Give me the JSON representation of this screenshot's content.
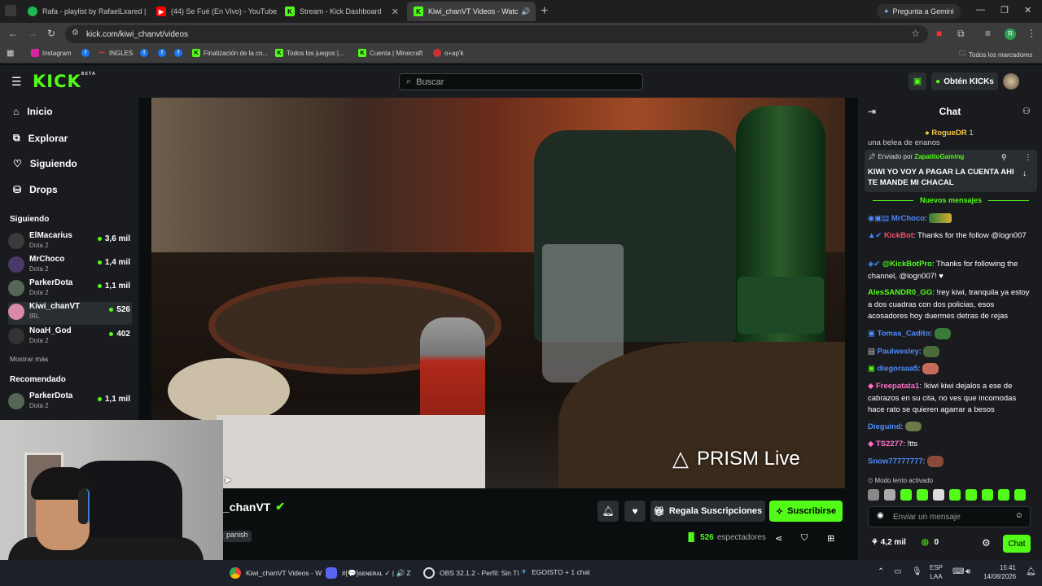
{
  "browser": {
    "tabs": [
      {
        "title": "Rafa - playlist by RafaelLxared |",
        "icon": "spotify-icon",
        "color": "#1db954"
      },
      {
        "title": "(44) Se Fué (En Vivo) - YouTube",
        "icon": "youtube-icon",
        "color": "#ff0000"
      },
      {
        "title": "Stream - Kick Dashboard",
        "icon": "kick-icon",
        "color": "#53fc18"
      },
      {
        "title": "Kiwi_chanVT Videos - Watc",
        "icon": "kick-icon",
        "color": "#53fc18"
      }
    ],
    "gemini_label": "Pregunta a Gemini",
    "url": "kick.com/kiwi_chanvt/videos",
    "bookmarks": [
      {
        "label": "Instagram",
        "icon": "instagram-icon"
      },
      {
        "label": "",
        "icon": "facebook-icon"
      },
      {
        "label": "INGLES",
        "icon": "ingles-icon"
      },
      {
        "label": "",
        "icon": "facebook-icon"
      },
      {
        "label": "",
        "icon": "facebook-icon"
      },
      {
        "label": "",
        "icon": "facebook-icon"
      },
      {
        "label": "Finalización de la co...",
        "icon": "bookmark-icon"
      },
      {
        "label": "Todos los juegos |...",
        "icon": "bookmark-icon"
      },
      {
        "label": "Cuenta | Minecraft",
        "icon": "bookmark-icon"
      },
      {
        "label": "o+ap'k",
        "icon": "bookmark-icon"
      }
    ],
    "all_bookmarks": "Todos los marcadores"
  },
  "kick": {
    "logo": "KICK",
    "logo_badge": "BETA",
    "search_placeholder": "Buscar",
    "get_kicks": "Obtén KICKs",
    "nav": [
      {
        "label": "Inicio",
        "icon": "home-icon"
      },
      {
        "label": "Explorar",
        "icon": "compass-icon"
      },
      {
        "label": "Siguiendo",
        "icon": "heart-icon"
      },
      {
        "label": "Drops",
        "icon": "drops-icon"
      }
    ],
    "following_title": "Siguiendo",
    "following": [
      {
        "name": "ElMacarius",
        "game": "Dota 2",
        "viewers": "3,6 mil",
        "color": "#3a3a3a"
      },
      {
        "name": "MrChoco",
        "game": "Dota 2",
        "viewers": "1,4 mil",
        "color": "#4a3a6a"
      },
      {
        "name": "ParkerDota",
        "game": "Dota 2",
        "viewers": "1,1 mil",
        "color": "#556655"
      },
      {
        "name": "Kiwi_chanVT",
        "game": "IRL",
        "viewers": "526",
        "color": "#d88aa6"
      },
      {
        "name": "NoaH_God",
        "game": "Dota 2",
        "viewers": "402",
        "color": "#333"
      }
    ],
    "show_more": "Mostrar más",
    "recommended_title": "Recomendado",
    "recommended": [
      {
        "name": "ParkerDota",
        "game": "Dota 2",
        "viewers": "1,1 mil",
        "color": "#556655"
      }
    ],
    "prism": "PRISM Live",
    "channel_name": "_chanVT",
    "language": "panish",
    "gift_label": "Regala Suscripciones",
    "subscribe_label": "Suscribirse",
    "viewers_count": "526",
    "viewers_label": "espectadores"
  },
  "chat": {
    "title": "Chat",
    "top_user": "RogueDR",
    "top_count": "1",
    "top_fragment": "una belea de enanos",
    "pinned_by_label": "Enviado por",
    "pinned_user": "ZapatitoGaming",
    "pinned_text": "KIWI YO VOY A PAGAR LA CUENTA AHI TE MANDE MI CHACAL",
    "new_messages": "Nuevos mensajes",
    "messages": [
      {
        "user": "MrChoco",
        "color": "#4f8cff",
        "text": ""
      },
      {
        "user": "KickBot",
        "color": "#ff4d6d",
        "text": "Thanks for the follow @logn007"
      },
      {
        "user": "@KickBotPro",
        "color": "#53fc18",
        "text": "Thanks for following the channel, @logn007! ♥"
      },
      {
        "user": "AlesSANDR0_GG",
        "color": "#53fc18",
        "text": "!rey kiwi, tranquila ya estoy a dos cuadras con dos policias, esos acosadores hoy duermes detras de rejas"
      },
      {
        "user": "Tomas_Cadito",
        "color": "#4f8cff",
        "text": ""
      },
      {
        "user": "Paulwesley",
        "color": "#4f8cff",
        "text": ""
      },
      {
        "user": "diegoraaa5",
        "color": "#4f8cff",
        "text": ""
      },
      {
        "user": "Freepatata1",
        "color": "#ff6ec7",
        "text": "!kiwi kiwi dejalos a ese de cabrazos en su cita, no ves que incomodas hace rato se quieren agarrar a besos"
      },
      {
        "user": "Dieguind",
        "color": "#4f8cff",
        "text": ""
      },
      {
        "user": "TS2277",
        "color": "#ff6ec7",
        "text": "!tts"
      },
      {
        "user": "Snow77777777",
        "color": "#4f8cff",
        "text": ""
      }
    ],
    "slow_mode": "Modo lento activado",
    "input_placeholder": "Enviar un mensaje",
    "kicks_count": "4,2 mil",
    "points": "0",
    "chat_button": "Chat"
  },
  "taskbar": {
    "items": [
      {
        "label": "Kiwi_chanVT Videos - W",
        "icon": "chrome-icon"
      },
      {
        "label": "#[💬]ɢᴇɴᴇʀᴀʟ ✓ | 🔊 Z",
        "icon": "discord-icon"
      },
      {
        "label": "OBS 32.1.2 - Perfil: Sin Tí",
        "icon": "obs-icon"
      },
      {
        "label": "EGOISTO + 1 chat",
        "icon": "app-icon"
      }
    ],
    "lang": "ESP",
    "lang2": "LAA",
    "time": "15:41",
    "date": "14/08/2026"
  }
}
